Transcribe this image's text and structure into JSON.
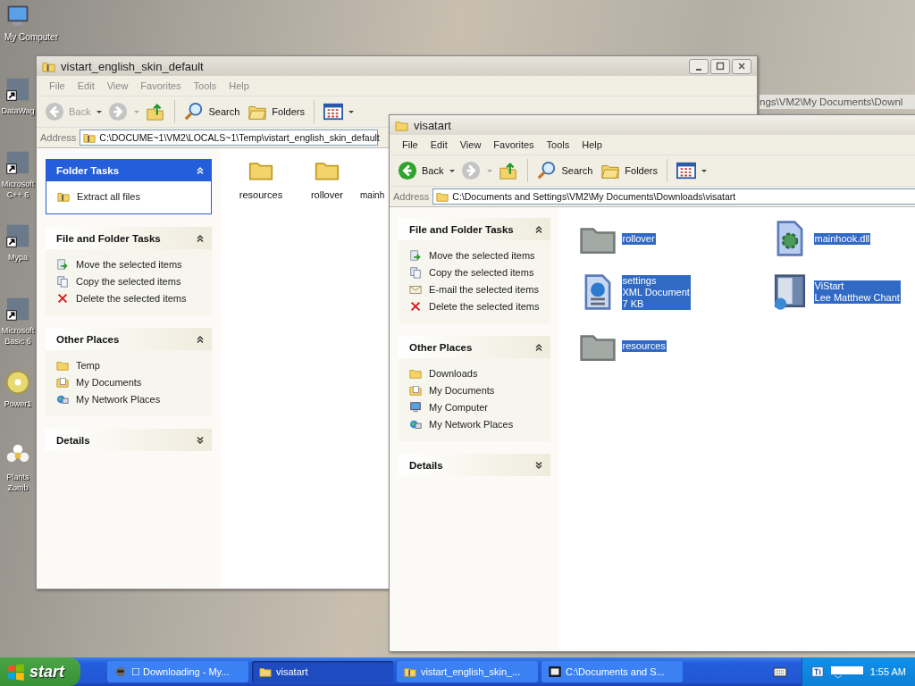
{
  "desktop_icons": [
    {
      "label": "My Computer",
      "kind": "computer"
    },
    {
      "label": "DataWag",
      "kind": "shortcut"
    },
    {
      "label": "Microsoft C++ 6",
      "kind": "shortcut"
    },
    {
      "label": "Mypa",
      "kind": "shortcut"
    },
    {
      "label": "Microsoft Basic 6",
      "kind": "shortcut"
    },
    {
      "label": "Power1",
      "kind": "disc"
    },
    {
      "label": "Plants Zomb",
      "kind": "flower"
    }
  ],
  "background_window_address": "ngs\\VM2\\My Documents\\Downl",
  "windows": [
    {
      "title": "vistart_english_skin_default",
      "kind": "zip",
      "active": false,
      "caption_buttons": true,
      "menu": [
        "File",
        "Edit",
        "View",
        "Favorites",
        "Tools",
        "Help"
      ],
      "toolbar": {
        "back": "Back",
        "back_disabled": true,
        "search": "Search",
        "folders": "Folders"
      },
      "address_label": "Address",
      "address": "C:\\DOCUME~1\\VM2\\LOCALS~1\\Temp\\vistart_english_skin_default",
      "sidebar": [
        {
          "title": "Folder Tasks",
          "kind": "special",
          "expanded": true,
          "items": [
            {
              "label": "Extract all files",
              "kind": "zip"
            }
          ]
        },
        {
          "title": "File and Folder Tasks",
          "kind": "normal",
          "expanded": true,
          "items": [
            {
              "label": "Move the selected items",
              "kind": "move"
            },
            {
              "label": "Copy the selected items",
              "kind": "copy"
            },
            {
              "label": "Delete the selected items",
              "kind": "delete"
            }
          ]
        },
        {
          "title": "Other Places",
          "kind": "normal",
          "expanded": true,
          "items": [
            {
              "label": "Temp",
              "kind": "folder"
            },
            {
              "label": "My Documents",
              "kind": "documents"
            },
            {
              "label": "My Network Places",
              "kind": "network"
            }
          ]
        },
        {
          "title": "Details",
          "kind": "normal",
          "expanded": false
        }
      ],
      "files": {
        "kind": "icons",
        "items": [
          {
            "lines": [
              "resources"
            ],
            "kind": "folder",
            "selected": false
          },
          {
            "lines": [
              "rollover"
            ],
            "kind": "folder",
            "selected": false
          },
          {
            "lines": [
              "mainh"
            ],
            "kind": "hidden",
            "selected": false
          }
        ]
      }
    },
    {
      "title": "visatart",
      "kind": "folder",
      "active": true,
      "caption_buttons": false,
      "menu": [
        "File",
        "Edit",
        "View",
        "Favorites",
        "Tools",
        "Help"
      ],
      "toolbar": {
        "back": "Back",
        "back_disabled": false,
        "search": "Search",
        "folders": "Folders"
      },
      "address_label": "Address",
      "address": "C:\\Documents and Settings\\VM2\\My Documents\\Downloads\\visatart",
      "sidebar": [
        {
          "title": "File and Folder Tasks",
          "kind": "normal",
          "expanded": true,
          "items": [
            {
              "label": "Move the selected items",
              "kind": "move"
            },
            {
              "label": "Copy the selected items",
              "kind": "copy"
            },
            {
              "label": "E-mail the selected items",
              "kind": "email"
            },
            {
              "label": "Delete the selected items",
              "kind": "delete"
            }
          ]
        },
        {
          "title": "Other Places",
          "kind": "normal",
          "expanded": true,
          "items": [
            {
              "label": "Downloads",
              "kind": "folder"
            },
            {
              "label": "My Documents",
              "kind": "documents"
            },
            {
              "label": "My Computer",
              "kind": "computer"
            },
            {
              "label": "My Network Places",
              "kind": "network"
            }
          ]
        },
        {
          "title": "Details",
          "kind": "normal",
          "expanded": false
        }
      ],
      "files": {
        "kind": "tiles",
        "items": [
          {
            "lines": [
              "rollover"
            ],
            "kind": "gfolder",
            "selected": true
          },
          {
            "lines": [
              "mainhook.dll"
            ],
            "kind": "dll",
            "selected": true
          },
          {
            "lines": [
              "settings",
              "XML Document",
              "7 KB"
            ],
            "kind": "xml",
            "selected": true
          },
          {
            "lines": [
              "ViStart",
              "Lee Matthew Chant"
            ],
            "kind": "app",
            "selected": true
          },
          {
            "lines": [
              "resources"
            ],
            "kind": "gfolder",
            "selected": true
          }
        ]
      }
    }
  ],
  "taskbar": {
    "start": "start",
    "tasks": [
      {
        "label": "☐ Downloading - My...",
        "kind": "web",
        "selected": false
      },
      {
        "label": "visatart",
        "kind": "folder",
        "selected": true
      },
      {
        "label": "vistart_english_skin_...",
        "kind": "zip",
        "selected": false
      },
      {
        "label": "C:\\Documents and S...",
        "kind": "archive",
        "selected": false
      }
    ],
    "clock": "1:55 AM"
  }
}
